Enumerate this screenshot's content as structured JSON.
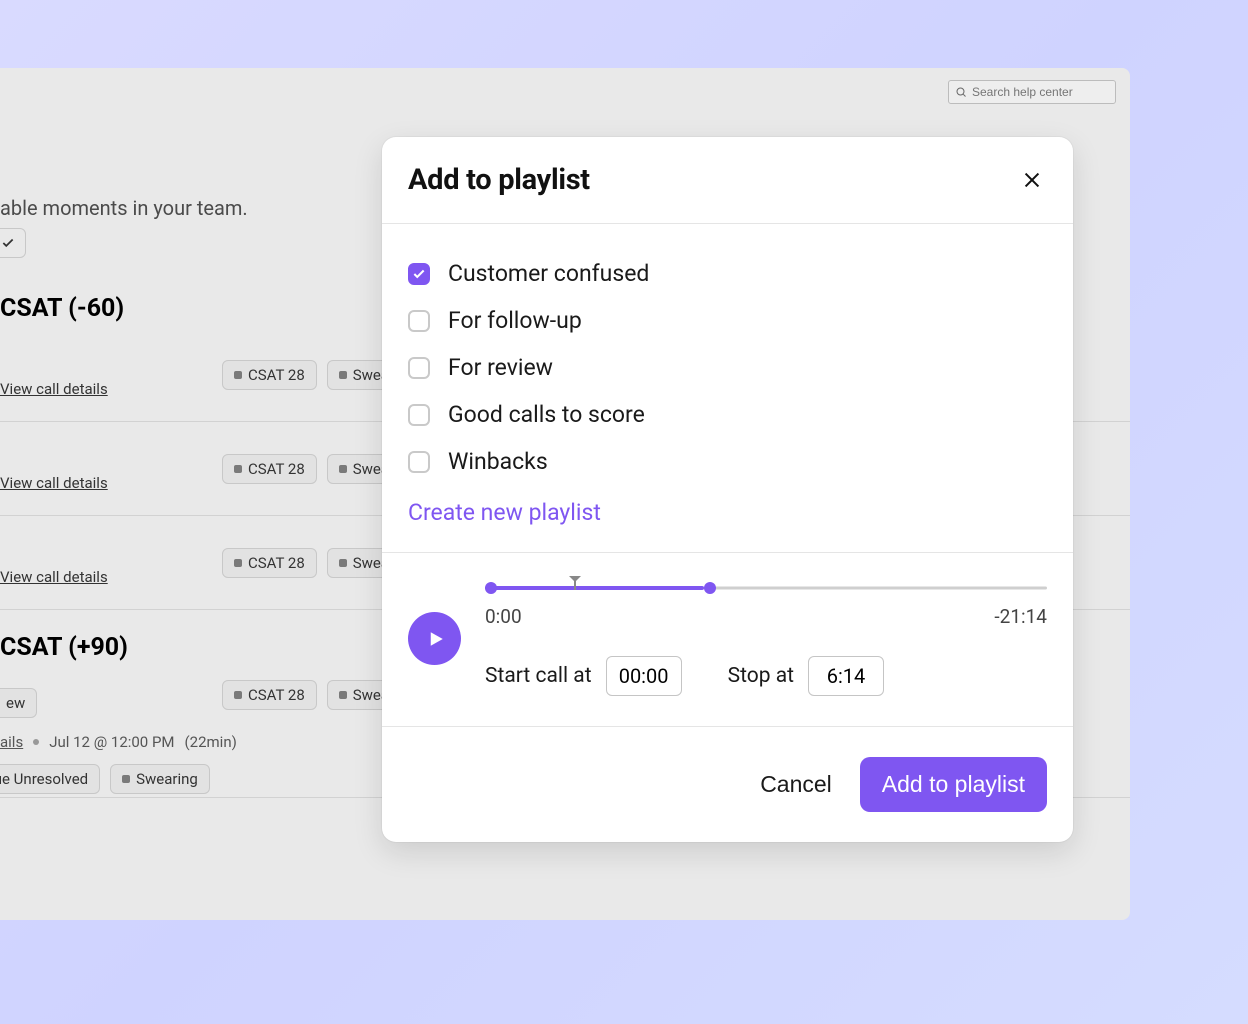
{
  "search": {
    "placeholder": "Search help center"
  },
  "bg": {
    "subtitle": "able moments in your team.",
    "heading_neg": "CSAT (-60)",
    "heading_pos": "CSAT (+90)",
    "view_link": "View call details",
    "view_link_short": "ails",
    "tag_csat": "CSAT 28",
    "tag_swearing_cut": "Sweari",
    "tag_issue": "sue Unresolved",
    "tag_swearing": "Swearing",
    "tag_new": "ew",
    "meta_time": "Jul 12 @ 12:00 PM",
    "meta_dur": "(22min)"
  },
  "modal": {
    "title": "Add to playlist",
    "playlists": [
      {
        "label": "Customer confused",
        "checked": true
      },
      {
        "label": "For follow-up",
        "checked": false
      },
      {
        "label": "For review",
        "checked": false
      },
      {
        "label": "Good calls to score",
        "checked": false
      },
      {
        "label": "Winbacks",
        "checked": false
      }
    ],
    "create_label": "Create new playlist",
    "player": {
      "current_time": "0:00",
      "remaining": "-21:14",
      "fill_pct": 39,
      "start_handle_pct": 1,
      "end_handle_pct": 40,
      "marker_pct": 16,
      "start_label": "Start call at",
      "stop_label": "Stop at",
      "start_value": "00:00",
      "stop_value": "6:14"
    },
    "cancel_label": "Cancel",
    "submit_label": "Add to playlist"
  }
}
